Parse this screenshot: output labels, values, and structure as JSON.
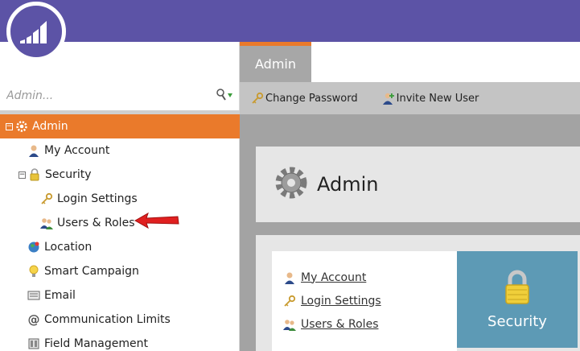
{
  "search": {
    "placeholder": "Admin..."
  },
  "tree": {
    "admin": "Admin",
    "my_account": "My Account",
    "security": "Security",
    "login_settings": "Login Settings",
    "users_roles": "Users & Roles",
    "location": "Location",
    "smart_campaign": "Smart Campaign",
    "email": "Email",
    "communication_limits": "Communication Limits",
    "field_management": "Field Management"
  },
  "tabs": {
    "admin": "Admin"
  },
  "toolbar": {
    "change_password": "Change Password",
    "invite_new_user": "Invite New User"
  },
  "panel": {
    "title": "Admin"
  },
  "links": {
    "my_account": "My Account",
    "login_settings": "Login Settings",
    "users_roles": "Users & Roles"
  },
  "tile": {
    "security": "Security"
  },
  "colors": {
    "brand": "#5c53a6",
    "active": "#ea7a2b",
    "tile": "#5d9ab5"
  },
  "icons": {
    "logo": "marketo-logo-icon",
    "filter": "filter-icon",
    "gear": "gear-icon",
    "person": "person-icon",
    "lock": "lock-icon",
    "key": "key-icon",
    "users": "users-icon",
    "globe": "globe-icon",
    "bulb": "lightbulb-icon",
    "email": "email-icon",
    "at": "at-sign-icon",
    "field": "field-management-icon",
    "add_user": "add-user-icon"
  }
}
